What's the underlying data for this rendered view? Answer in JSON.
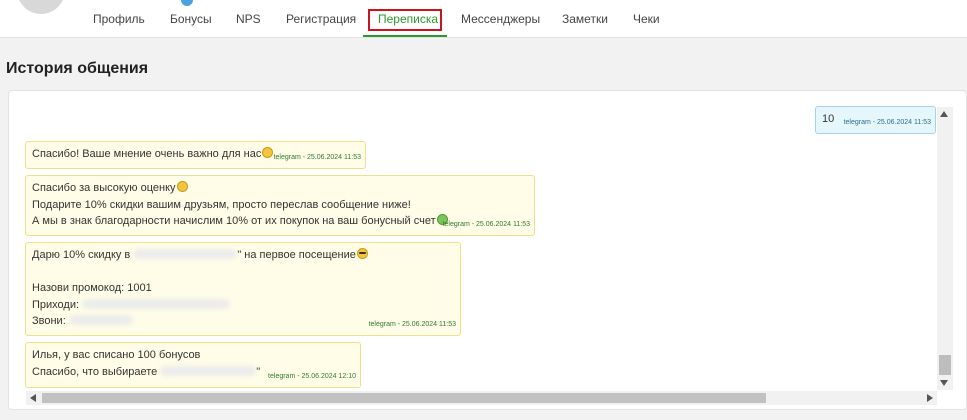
{
  "tabs": [
    {
      "label": "Профиль"
    },
    {
      "label": "Бонусы"
    },
    {
      "label": "NPS"
    },
    {
      "label": "Регистрация"
    },
    {
      "label": "Переписка",
      "active": true
    },
    {
      "label": "Мессенджеры"
    },
    {
      "label": "Заметки"
    },
    {
      "label": "Чеки"
    }
  ],
  "section": {
    "title": "История общения"
  },
  "messages": [
    {
      "direction": "outgoing",
      "lines": [
        "10"
      ],
      "meta": "telegram - 25.06.2024 11:53"
    },
    {
      "direction": "incoming",
      "lines": [
        "Спасибо! Ваше мнение очень важно для нас"
      ],
      "meta": "telegram - 25.06.2024 11:53"
    },
    {
      "direction": "incoming",
      "lines": [
        "Спасибо за высокую оценку",
        "Подарите 10% скидки вашим друзьям, просто переслав сообщение ниже!",
        "А мы в знак благодарности начислим 10% от их покупок на ваш бонусный счет"
      ],
      "meta": "telegram - 25.06.2024 11:53"
    },
    {
      "direction": "incoming",
      "lines": [
        "Дарю 10% скидку в ",
        "\" на первое посещение",
        "",
        "Назови промокод: 1001",
        "Приходи: ",
        "Звони: "
      ],
      "meta": "telegram - 25.06.2024 11:53"
    },
    {
      "direction": "incoming",
      "lines": [
        "Илья, у вас списано 100 бонусов",
        "Спасибо, что выбираете ",
        "\""
      ],
      "meta": "telegram - 25.06.2024 12:10"
    }
  ],
  "colors": {
    "accent": "#2e9a2e",
    "highlight": "#c9141b",
    "incoming_bg": "#fffde7",
    "outgoing_bg": "#e6f6fd"
  },
  "icons": {
    "emoji_smile": "smile-emoji-icon",
    "emoji_grin": "grin-emoji-icon",
    "emoji_money": "money-face-emoji-icon",
    "emoji_cool": "sunglasses-emoji-icon"
  }
}
